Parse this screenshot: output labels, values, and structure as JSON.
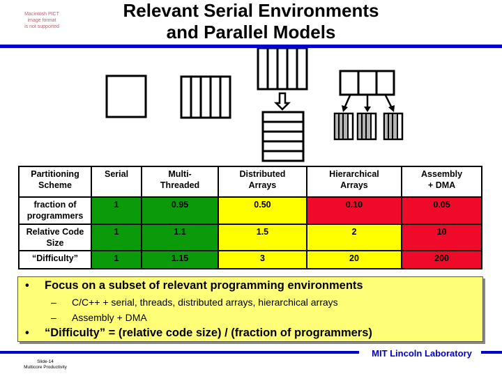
{
  "header": {
    "placeholder_note": [
      "Macintosh PICT",
      "image format",
      "is not supported"
    ],
    "title_line1": "Relevant Serial Environments",
    "title_line2": "and Parallel Models"
  },
  "diagram": {
    "models": [
      "serial",
      "multi-threaded",
      "distributed-arrays",
      "hierarchical-arrays"
    ],
    "colors": {
      "shaded": "#b4b4b4",
      "stroke": "#000000"
    }
  },
  "table": {
    "header": [
      "Partitioning Scheme",
      "Serial",
      "Multi-Threaded",
      "Distributed Arrays",
      "Hierarchical Arrays",
      "Assembly + DMA"
    ],
    "header_lines": [
      [
        "Partitioning",
        "Scheme"
      ],
      [
        "Serial",
        ""
      ],
      [
        "Multi-",
        "Threaded"
      ],
      [
        "Distributed",
        "Arrays"
      ],
      [
        "Hierarchical",
        "Arrays"
      ],
      [
        "Assembly",
        "+ DMA"
      ]
    ],
    "rows": [
      {
        "label_lines": [
          "fraction of",
          "programmers"
        ],
        "values": [
          "1",
          "0.95",
          "0.50",
          "0.10",
          "0.05"
        ],
        "colors": [
          "green",
          "green",
          "yellow",
          "red",
          "red"
        ]
      },
      {
        "label_lines": [
          "Relative Code",
          "Size"
        ],
        "values": [
          "1",
          "1.1",
          "1.5",
          "2",
          "10"
        ],
        "colors": [
          "green",
          "green",
          "yellow",
          "yellow",
          "red"
        ]
      },
      {
        "label_lines": [
          "“Difficulty”",
          ""
        ],
        "values": [
          "1",
          "1.15",
          "3",
          "20",
          "200"
        ],
        "colors": [
          "green",
          "green",
          "yellow",
          "yellow",
          "red"
        ]
      }
    ],
    "color_map": {
      "green": "#0a9a0a",
      "yellow": "#ffff00",
      "red": "#ee0a28"
    }
  },
  "callout": {
    "bullet": "•",
    "dash": "–",
    "item1": "Focus on a subset of relevant programming environments",
    "sub1": "C/C++ + serial, threads, distributed arrays, hierarchical arrays",
    "sub2": "Assembly + DMA",
    "item2": "“Difficulty” = (relative code size) / (fraction of programmers)"
  },
  "footer": {
    "slide": "Slide-14",
    "course": "Multicore Productivity",
    "lab": "MIT Lincoln Laboratory"
  }
}
